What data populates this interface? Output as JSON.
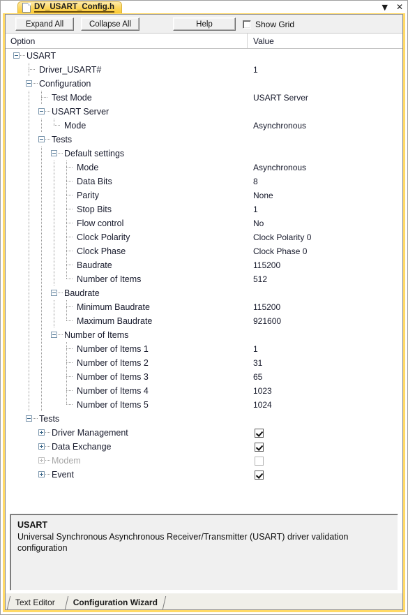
{
  "window": {
    "tab_title": "DV_USART_Config.h",
    "file_icon": "file-icon",
    "dropdown_icon": "▼",
    "close_icon": "✕"
  },
  "toolbar": {
    "expand_all": "Expand All",
    "collapse_all": "Collapse All",
    "help": "Help",
    "show_grid_label": "Show Grid",
    "show_grid_checked": false
  },
  "columns": {
    "option": "Option",
    "value": "Value"
  },
  "tree": [
    {
      "indent": 0,
      "expander": "minus",
      "label": "USART",
      "value": ""
    },
    {
      "indent": 1,
      "expander": "none",
      "label": "Driver_USART#",
      "value": "1"
    },
    {
      "indent": 1,
      "expander": "minus",
      "label": "Configuration",
      "value": ""
    },
    {
      "indent": 2,
      "expander": "none",
      "label": "Test Mode",
      "value": "USART Server"
    },
    {
      "indent": 2,
      "expander": "minus",
      "label": "USART Server",
      "value": ""
    },
    {
      "indent": 3,
      "expander": "none",
      "label": "Mode",
      "value": "Asynchronous"
    },
    {
      "indent": 2,
      "expander": "minus",
      "label": "Tests",
      "value": ""
    },
    {
      "indent": 3,
      "expander": "minus",
      "label": "Default settings",
      "value": ""
    },
    {
      "indent": 4,
      "expander": "none",
      "label": "Mode",
      "value": "Asynchronous"
    },
    {
      "indent": 4,
      "expander": "none",
      "label": "Data Bits",
      "value": "8"
    },
    {
      "indent": 4,
      "expander": "none",
      "label": "Parity",
      "value": "None"
    },
    {
      "indent": 4,
      "expander": "none",
      "label": "Stop Bits",
      "value": "1"
    },
    {
      "indent": 4,
      "expander": "none",
      "label": "Flow control",
      "value": "No"
    },
    {
      "indent": 4,
      "expander": "none",
      "label": "Clock Polarity",
      "value": "Clock Polarity 0"
    },
    {
      "indent": 4,
      "expander": "none",
      "label": "Clock Phase",
      "value": "Clock Phase 0"
    },
    {
      "indent": 4,
      "expander": "none",
      "label": "Baudrate",
      "value": "115200"
    },
    {
      "indent": 4,
      "expander": "none",
      "label": "Number of Items",
      "value": "512"
    },
    {
      "indent": 3,
      "expander": "minus",
      "label": "Baudrate",
      "value": ""
    },
    {
      "indent": 4,
      "expander": "none",
      "label": "Minimum Baudrate",
      "value": "115200"
    },
    {
      "indent": 4,
      "expander": "none",
      "label": "Maximum Baudrate",
      "value": "921600"
    },
    {
      "indent": 3,
      "expander": "minus",
      "label": "Number of Items",
      "value": ""
    },
    {
      "indent": 4,
      "expander": "none",
      "label": "Number of Items 1",
      "value": "1"
    },
    {
      "indent": 4,
      "expander": "none",
      "label": "Number of Items 2",
      "value": "31"
    },
    {
      "indent": 4,
      "expander": "none",
      "label": "Number of Items 3",
      "value": "65"
    },
    {
      "indent": 4,
      "expander": "none",
      "label": "Number of Items 4",
      "value": "1023"
    },
    {
      "indent": 4,
      "expander": "none",
      "label": "Number of Items 5",
      "value": "1024"
    },
    {
      "indent": 1,
      "expander": "minus",
      "label": "Tests",
      "value": ""
    },
    {
      "indent": 2,
      "expander": "plus",
      "label": "Driver Management",
      "checkbox": "checked"
    },
    {
      "indent": 2,
      "expander": "plus",
      "label": "Data Exchange",
      "checkbox": "checked"
    },
    {
      "indent": 2,
      "expander": "plus",
      "label": "Modem",
      "checkbox": "unchecked",
      "disabled": true
    },
    {
      "indent": 2,
      "expander": "plus",
      "label": "Event",
      "checkbox": "checked"
    }
  ],
  "description": {
    "title": "USART",
    "text": "Universal Synchronous Asynchronous Receiver/Transmitter (USART) driver validation configuration"
  },
  "bottom_tabs": [
    {
      "label": "Text Editor",
      "active": false
    },
    {
      "label": "Configuration Wizard",
      "active": true
    }
  ]
}
